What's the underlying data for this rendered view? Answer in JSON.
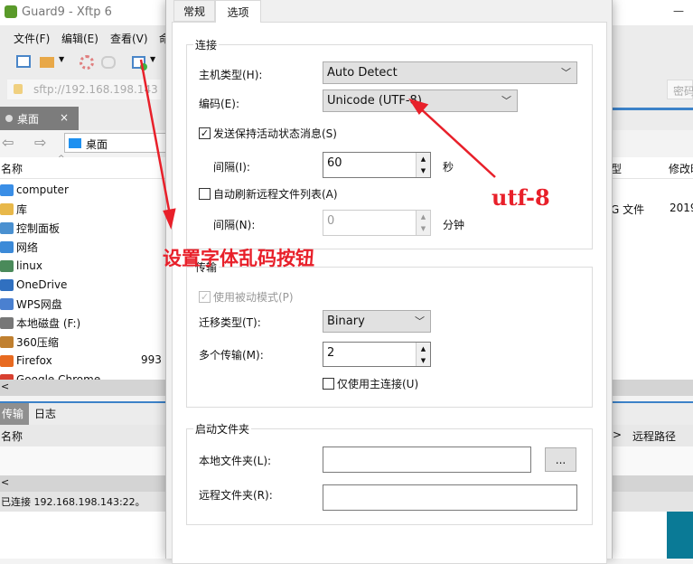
{
  "window": {
    "title": "Guard9 - Xftp 6",
    "minimize": "—"
  },
  "menu": [
    "文件(F)",
    "编辑(E)",
    "查看(V)",
    "命"
  ],
  "address": {
    "url": "sftp://192.168.198.143",
    "password_placeholder": "密码"
  },
  "local_tab": {
    "label": "桌面",
    "close": "×"
  },
  "nav": {
    "path": "桌面"
  },
  "file_list": {
    "headers": [
      "名称",
      "型",
      "修改时间"
    ],
    "items": [
      {
        "name": "computer",
        "color": "#3a8ee6"
      },
      {
        "name": "库",
        "color": "#e8b84a"
      },
      {
        "name": "控制面板",
        "color": "#4a90d0"
      },
      {
        "name": "网络",
        "color": "#3c8ad8"
      },
      {
        "name": "linux",
        "color": "#4a8a5a"
      },
      {
        "name": "OneDrive",
        "color": "#3070c0"
      },
      {
        "name": "WPS网盘",
        "color": "#4a80d0"
      },
      {
        "name": "本地磁盘 (F:)",
        "color": "#777777"
      },
      {
        "name": "360压缩",
        "color": "#c08030"
      },
      {
        "name": "Firefox",
        "size": "993",
        "color": "#e86a20"
      },
      {
        "name": "Google Chrome",
        "color": "#d84030"
      }
    ],
    "right_row": {
      "type": "G 文件",
      "date": "2019"
    }
  },
  "bottom": {
    "tabs": [
      "传输",
      "日志"
    ],
    "headers": [
      "名称",
      "远程路径"
    ],
    "arrow": ">"
  },
  "status": "已连接 192.168.198.143:22。",
  "dialog": {
    "tabs": [
      "常规",
      "选项"
    ],
    "active_tab": "选项",
    "connection": {
      "title": "连接",
      "host_type_label": "主机类型(H):",
      "host_type": "Auto Detect",
      "encoding_label": "编码(E):",
      "encoding": "Unicode (UTF-8)",
      "keepalive_label": "发送保持活动状态消息(S)",
      "keepalive_checked": true,
      "interval_label": "间隔(I):",
      "interval": "60",
      "interval_unit": "秒",
      "auto_refresh_label": "自动刷新远程文件列表(A)",
      "auto_refresh_checked": false,
      "refresh_interval_label": "间隔(N):",
      "refresh_interval": "0",
      "refresh_unit": "分钟"
    },
    "transfer": {
      "title": "传输",
      "passive_label": "使用被动模式(P)",
      "passive_checked": true,
      "type_label": "迁移类型(T):",
      "type": "Binary",
      "multi_label": "多个传输(M):",
      "multi": "2",
      "primary_only_label": "仅使用主连接(U)",
      "primary_only_checked": false
    },
    "startup": {
      "title": "启动文件夹",
      "local_label": "本地文件夹(L):",
      "local": "",
      "browse": "...",
      "remote_label": "远程文件夹(R):",
      "remote": ""
    }
  },
  "annotations": {
    "encoding_note": "utf-8",
    "button_note": "设置字体乱码按钮",
    "color": "#e8202a"
  }
}
